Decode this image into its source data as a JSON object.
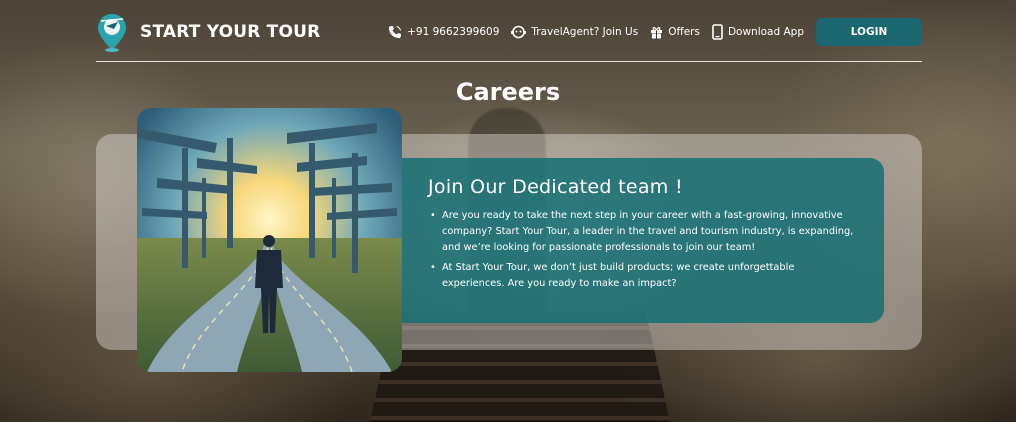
{
  "brand": {
    "name": "START YOUR TOUR",
    "logo_icon": "map-pin-logo-icon"
  },
  "nav": {
    "phone": {
      "label": "+91 9662399609",
      "icon": "phone-icon"
    },
    "agent": {
      "label": "TravelAgent? Join Us",
      "icon": "agent-icon"
    },
    "offers": {
      "label": "Offers",
      "icon": "gift-icon"
    },
    "download": {
      "label": "Download App",
      "icon": "mobile-icon"
    },
    "login": {
      "label": "LOGIN"
    }
  },
  "page": {
    "title": "Careers"
  },
  "card": {
    "title": "Join Our Dedicated team !",
    "bullets": [
      "Are you ready to take the next step in your career with a fast-growing, innovative company? Start Your Tour, a leader in the travel and tourism industry, is expanding, and we’re looking for passionate professionals to join our team!",
      "At Start Your Tour, we don’t just build products; we create unforgettable experiences. Are you ready to make an impact?"
    ]
  },
  "colors": {
    "accent": "#1a6770",
    "card_bg": "#146e73",
    "text": "#ffffff"
  }
}
